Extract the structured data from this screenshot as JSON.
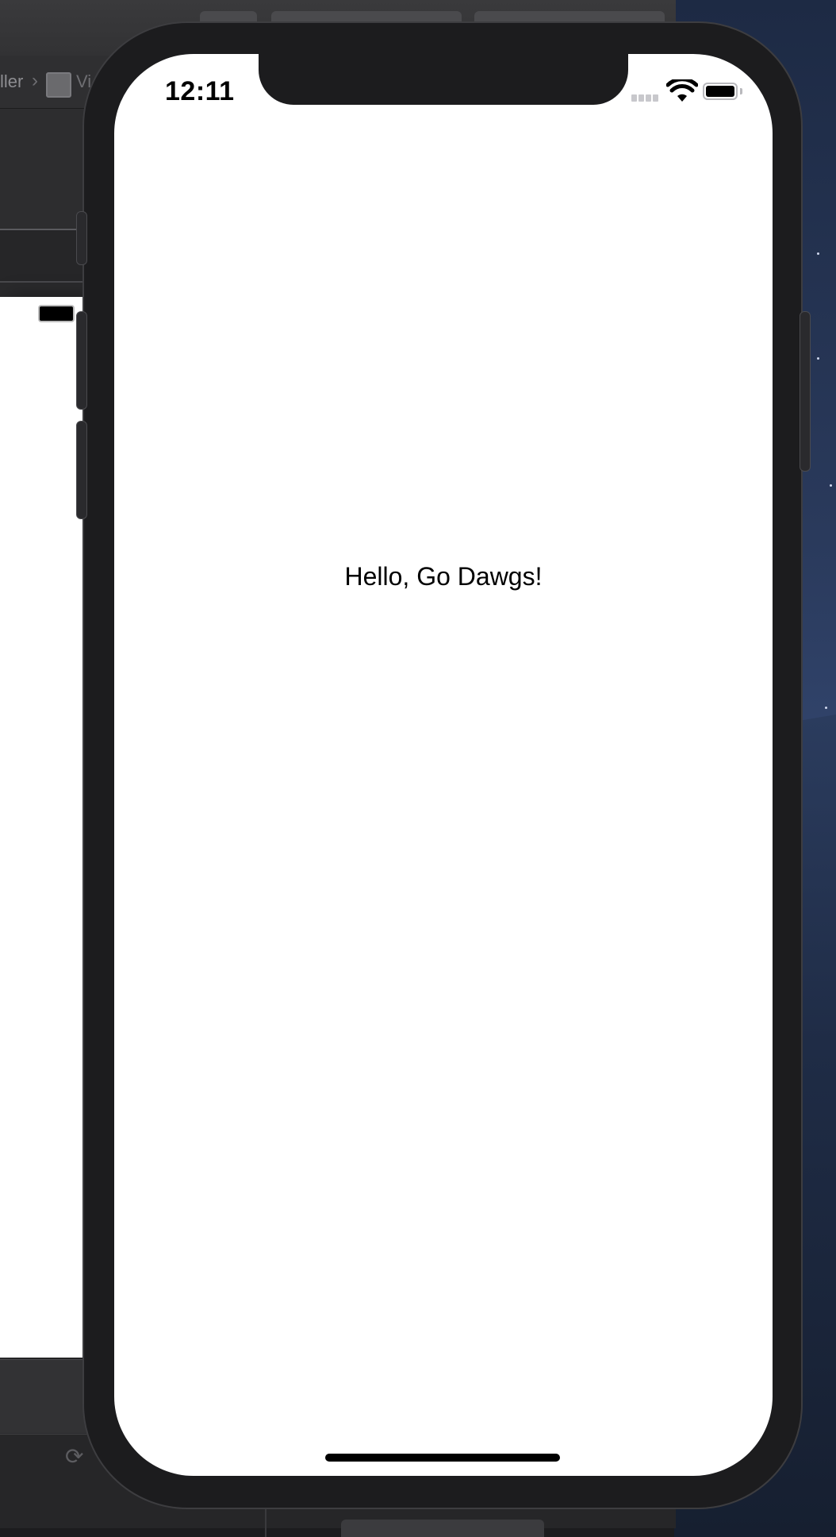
{
  "xcode": {
    "breadcrumb_left": "ller",
    "breadcrumb_right": "Vi",
    "bottom_icon": "refresh-icon"
  },
  "phone": {
    "status_bar": {
      "time": "12:11",
      "signal_icon": "cellular-signal-icon",
      "wifi_icon": "wifi-icon",
      "battery_icon": "battery-icon"
    },
    "content": {
      "label": "Hello, Go Dawgs!"
    }
  },
  "colors": {
    "screen_background": "#ffffff",
    "phone_bezel": "#1c1c1e",
    "label_text": "#000000"
  }
}
